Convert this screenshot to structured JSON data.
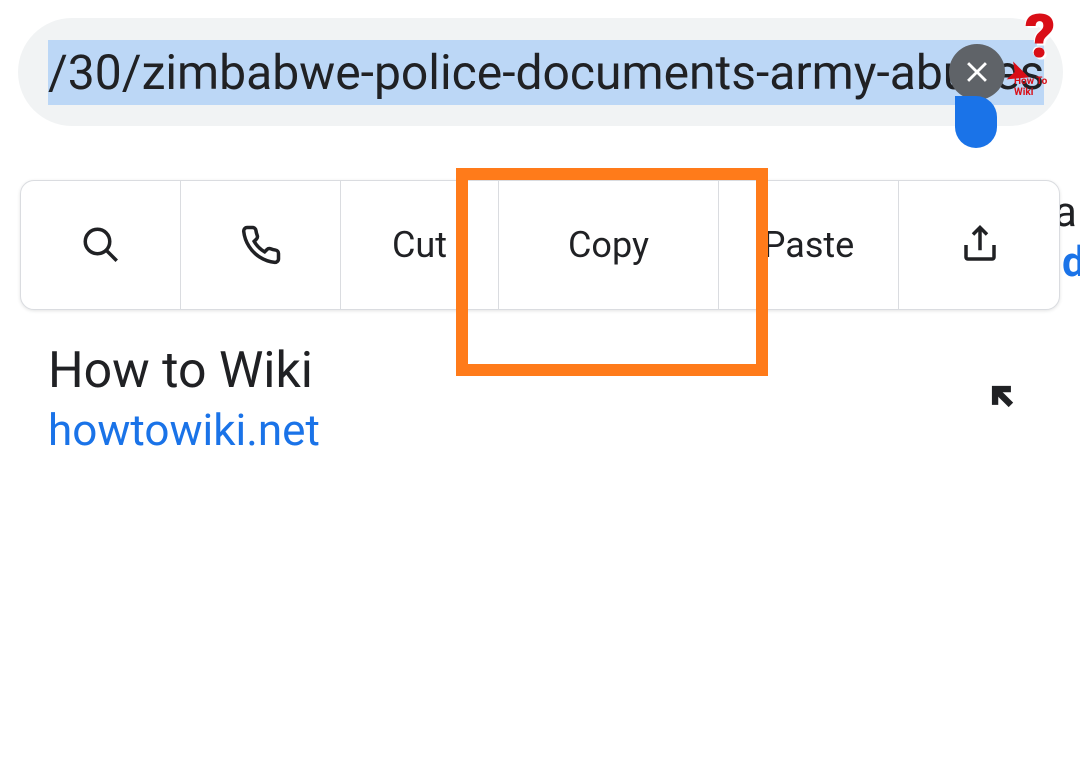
{
  "url_bar": {
    "visible_text": "/30/zimbabwe-police-documents-army-abuses",
    "clear_label": "Clear"
  },
  "logo": {
    "text": "How To Wiki"
  },
  "context_menu": {
    "cut": "Cut",
    "copy": "Copy",
    "paste": "Paste"
  },
  "edge": {
    "line1": "a",
    "line2": "d"
  },
  "suggestion": {
    "title": "How to Wiki",
    "url": "howtowiki.net"
  }
}
